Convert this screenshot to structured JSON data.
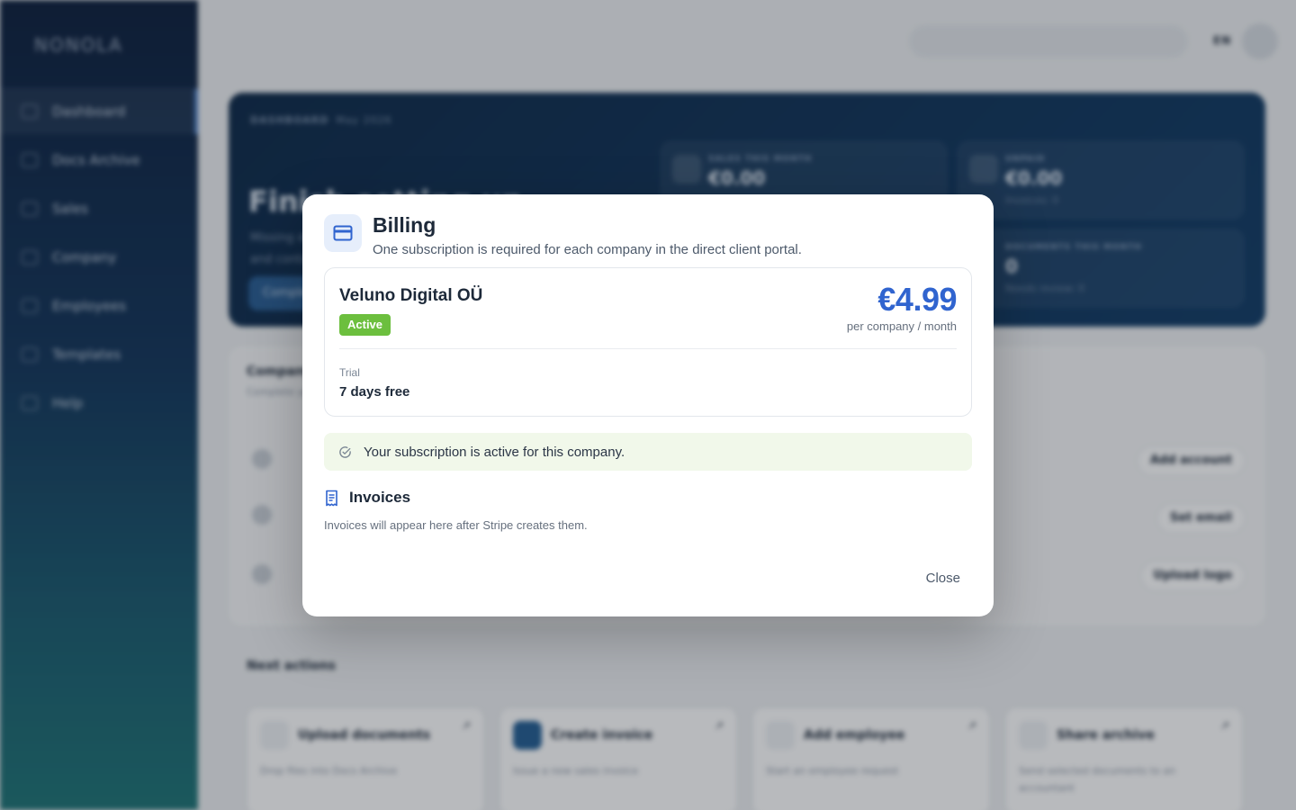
{
  "background": {
    "logo": "NONOLA",
    "nav": [
      {
        "label": "Dashboard",
        "active": true
      },
      {
        "label": "Docs Archive"
      },
      {
        "label": "Sales"
      },
      {
        "label": "Company"
      },
      {
        "label": "Employees"
      },
      {
        "label": "Templates"
      },
      {
        "label": "Help"
      }
    ],
    "language": "EN",
    "breadcrumb": {
      "section": "DASHBOARD",
      "period": "May 2026"
    },
    "hero": {
      "title": "Finish setting up",
      "description": "Missing details for your company pool, brand and contacts.",
      "button": "Complete"
    },
    "stats": [
      {
        "label": "SALES THIS MONTH",
        "value": "€0.00",
        "sub": ""
      },
      {
        "label": "UNPAID",
        "value": "€0.00",
        "sub": "Invoices: 0"
      },
      {
        "label": "DOCUMENTS THIS MONTH",
        "value": "0",
        "sub": "Needs review: 0"
      }
    ],
    "setup": {
      "title": "Company setup",
      "subtitle": "Complete your company profile",
      "buttons": [
        "Add account",
        "Set email",
        "Upload logo"
      ]
    },
    "next_actions": {
      "title": "Next actions",
      "cards": [
        {
          "title": "Upload documents",
          "desc": "Drop files into Docs Archive"
        },
        {
          "title": "Create invoice",
          "desc": "Issue a new sales invoice"
        },
        {
          "title": "Add employee",
          "desc": "Start an employee request"
        },
        {
          "title": "Share archive",
          "desc": "Send selected documents to an accountant"
        }
      ]
    }
  },
  "modal": {
    "title": "Billing",
    "subtitle": "One subscription is required for each company in the direct client portal.",
    "subscription": {
      "company": "Veluno Digital OÜ",
      "status": "Active",
      "price": "€4.99",
      "period": "per company / month",
      "trial_label": "Trial",
      "trial_value": "7 days free"
    },
    "notice": "Your subscription is active for this company.",
    "invoices": {
      "title": "Invoices",
      "empty": "Invoices will appear here after Stripe creates them."
    },
    "close_label": "Close"
  },
  "colors": {
    "accent": "#3064cf",
    "active_badge": "#6cbf3e",
    "notice_bg": "#f1f8ea"
  }
}
